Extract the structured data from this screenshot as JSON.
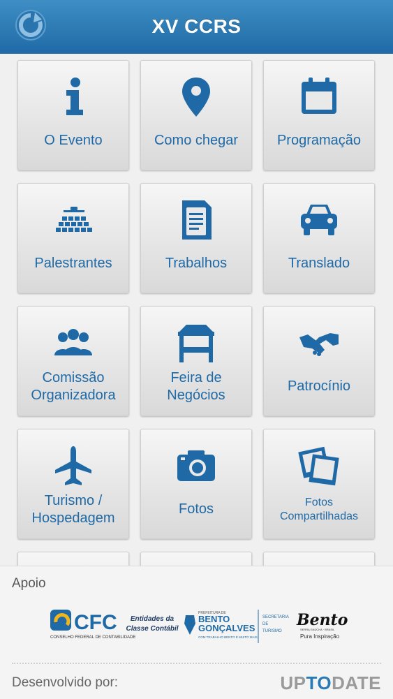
{
  "header": {
    "title": "XV CCRS",
    "refresh_icon": "refresh-icon"
  },
  "colors": {
    "accent": "#1f6aa6",
    "header": "#2f7db8"
  },
  "tiles": [
    {
      "label_lines": [
        "O Evento"
      ],
      "icon": "info-icon"
    },
    {
      "label_lines": [
        "Como chegar"
      ],
      "icon": "map-pin-icon"
    },
    {
      "label_lines": [
        "Programação"
      ],
      "icon": "calendar-icon"
    },
    {
      "label_lines": [
        "Palestrantes"
      ],
      "icon": "audience-icon"
    },
    {
      "label_lines": [
        "Trabalhos"
      ],
      "icon": "document-icon"
    },
    {
      "label_lines": [
        "Translado"
      ],
      "icon": "car-icon"
    },
    {
      "label_lines": [
        "Comissão",
        "Organizadora"
      ],
      "icon": "group-icon"
    },
    {
      "label_lines": [
        "Feira de",
        "Negócios"
      ],
      "icon": "booth-icon"
    },
    {
      "label_lines": [
        "Patrocínio"
      ],
      "icon": "handshake-icon"
    },
    {
      "label_lines": [
        "Turismo /",
        "Hospedagem"
      ],
      "icon": "airplane-icon"
    },
    {
      "label_lines": [
        "Fotos"
      ],
      "icon": "camera-icon"
    },
    {
      "label_lines": [
        "Fotos",
        "Compartilhadas"
      ],
      "icon": "photos-icon"
    }
  ],
  "footer": {
    "apoio_label": "Apoio",
    "logos": {
      "cfc": "CFC",
      "cfc_subtitle": "CONSELHO FEDERAL DE CONTABILIDADE",
      "entidades": [
        "Entidades da",
        "Classe Contábil"
      ],
      "bento_small": "PREFEITURA DE",
      "bento_line1": "BENTO",
      "bento_line2": "GONÇALVES",
      "bento_tagline": "COM TRABALHO BENTO É MUITO MAIS",
      "secretaria": [
        "SECRETARIA",
        "DE",
        "TURISMO"
      ],
      "bento_script": "Bento",
      "serra": "SERRA GAÚCHA · BRASIL",
      "pura": "Pura Inspiração"
    },
    "developed_by": "Desenvolvido por:",
    "brand_up": "UP",
    "brand_to": "TO",
    "brand_date": "DATE"
  }
}
